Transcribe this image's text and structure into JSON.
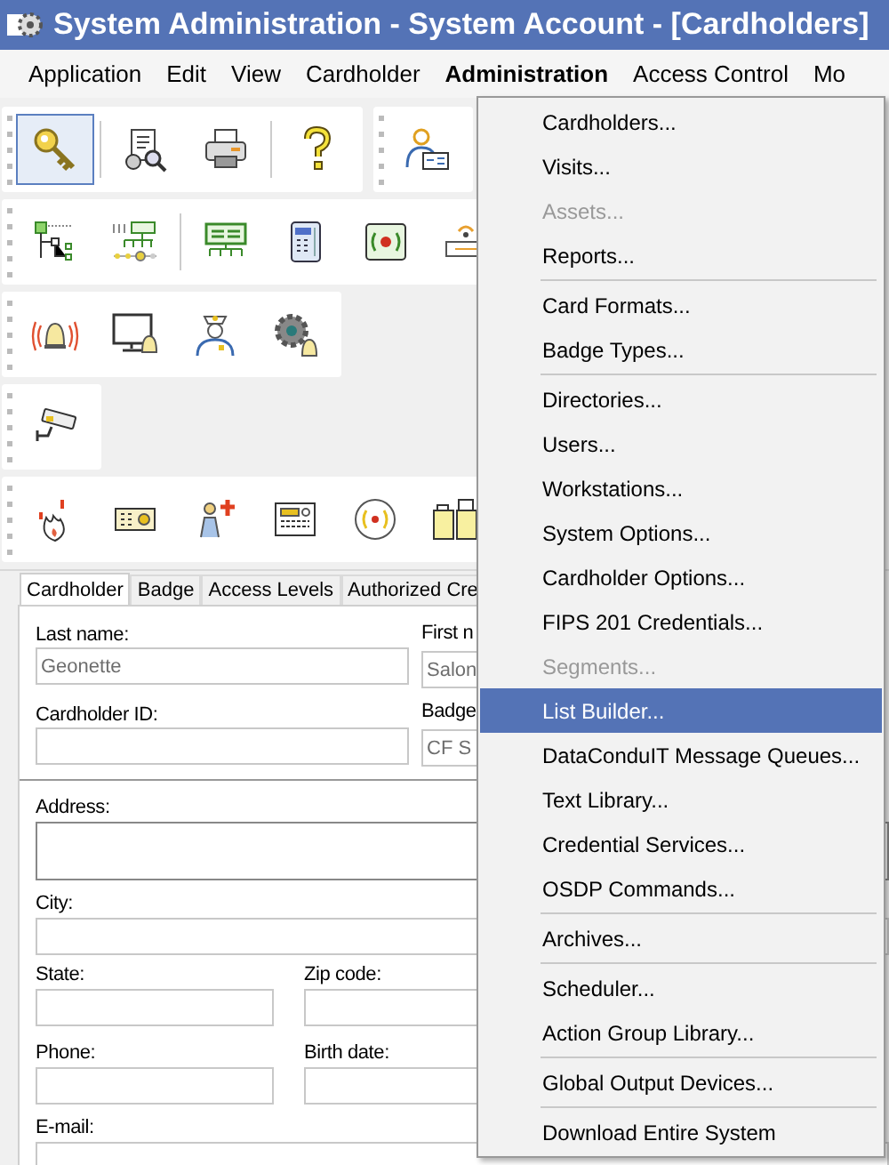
{
  "window": {
    "title": "System Administration - System Account - [Cardholders]"
  },
  "menu_bar": [
    {
      "label": "Application",
      "selected": false
    },
    {
      "label": "Edit",
      "selected": false
    },
    {
      "label": "View",
      "selected": false
    },
    {
      "label": "Cardholder",
      "selected": false
    },
    {
      "label": "Administration",
      "selected": true
    },
    {
      "label": "Access Control",
      "selected": false
    },
    {
      "label": "Mo",
      "selected": false
    }
  ],
  "toolbars": [
    {
      "buttons": [
        {
          "kind": "button",
          "selected": true
        },
        {
          "kind": "separator"
        },
        {
          "kind": "button",
          "selected": false
        },
        {
          "kind": "button",
          "selected": false
        },
        {
          "kind": "separator"
        },
        {
          "kind": "button",
          "selected": false
        }
      ]
    },
    {
      "buttons": [
        {
          "kind": "button",
          "selected": false
        }
      ]
    },
    {
      "buttons": [
        {
          "kind": "button",
          "selected": false
        },
        {
          "kind": "button",
          "selected": false
        },
        {
          "kind": "separator"
        },
        {
          "kind": "button",
          "selected": false
        },
        {
          "kind": "button",
          "selected": false
        },
        {
          "kind": "button",
          "selected": false
        },
        {
          "kind": "button",
          "selected": false
        }
      ]
    },
    {
      "buttons": [
        {
          "kind": "button",
          "selected": false
        },
        {
          "kind": "button",
          "selected": false
        },
        {
          "kind": "button",
          "selected": false
        },
        {
          "kind": "button",
          "selected": false
        }
      ]
    },
    {
      "buttons": [
        {
          "kind": "button",
          "selected": false
        }
      ]
    },
    {
      "buttons": [
        {
          "kind": "button",
          "selected": false
        },
        {
          "kind": "button",
          "selected": false
        },
        {
          "kind": "button",
          "selected": false
        },
        {
          "kind": "button",
          "selected": false
        },
        {
          "kind": "button",
          "selected": false
        },
        {
          "kind": "button",
          "selected": false
        }
      ]
    }
  ],
  "tabs": [
    {
      "label": "Cardholder",
      "selected": true
    },
    {
      "label": "Badge",
      "selected": false
    },
    {
      "label": "Access Levels",
      "selected": false
    },
    {
      "label": "Authorized Cre",
      "selected": false
    }
  ],
  "form": {
    "last_name": {
      "label": "Last name:",
      "value": "Geonette",
      "disabled": true
    },
    "first_name": {
      "label": "First n",
      "value": "Salon",
      "disabled": true
    },
    "cardholder_id": {
      "label": "Cardholder ID:"
    },
    "badge": {
      "label": "Badge",
      "value": "CF S",
      "disabled": true
    },
    "address": {
      "label": "Address:"
    },
    "city": {
      "label": "City:"
    },
    "state": {
      "label": "State:"
    },
    "zip_code": {
      "label": "Zip code:"
    },
    "phone": {
      "label": "Phone:"
    },
    "birth_date": {
      "label": "Birth date:"
    },
    "email": {
      "label": "E-mail:"
    }
  },
  "dropdown_menu": [
    {
      "kind": "item",
      "label": "Cardholders...",
      "disabled": false,
      "selected": false
    },
    {
      "kind": "item",
      "label": "Visits...",
      "disabled": false,
      "selected": false
    },
    {
      "kind": "item",
      "label": "Assets...",
      "disabled": true,
      "selected": false
    },
    {
      "kind": "item",
      "label": "Reports...",
      "disabled": false,
      "selected": false
    },
    {
      "kind": "separator"
    },
    {
      "kind": "item",
      "label": "Card Formats...",
      "disabled": false,
      "selected": false
    },
    {
      "kind": "item",
      "label": "Badge Types...",
      "disabled": false,
      "selected": false
    },
    {
      "kind": "separator"
    },
    {
      "kind": "item",
      "label": "Directories...",
      "disabled": false,
      "selected": false
    },
    {
      "kind": "item",
      "label": "Users...",
      "disabled": false,
      "selected": false
    },
    {
      "kind": "item",
      "label": "Workstations...",
      "disabled": false,
      "selected": false
    },
    {
      "kind": "item",
      "label": "System Options...",
      "disabled": false,
      "selected": false
    },
    {
      "kind": "item",
      "label": "Cardholder Options...",
      "disabled": false,
      "selected": false
    },
    {
      "kind": "item",
      "label": "FIPS 201 Credentials...",
      "disabled": false,
      "selected": false
    },
    {
      "kind": "item",
      "label": "Segments...",
      "disabled": true,
      "selected": false
    },
    {
      "kind": "item",
      "label": "List Builder...",
      "disabled": false,
      "selected": true
    },
    {
      "kind": "item",
      "label": "DataConduIT Message Queues...",
      "disabled": false,
      "selected": false
    },
    {
      "kind": "item",
      "label": "Text Library...",
      "disabled": false,
      "selected": false
    },
    {
      "kind": "item",
      "label": "Credential Services...",
      "disabled": false,
      "selected": false
    },
    {
      "kind": "item",
      "label": "OSDP Commands...",
      "disabled": false,
      "selected": false
    },
    {
      "kind": "separator"
    },
    {
      "kind": "item",
      "label": "Archives...",
      "disabled": false,
      "selected": false
    },
    {
      "kind": "separator"
    },
    {
      "kind": "item",
      "label": "Scheduler...",
      "disabled": false,
      "selected": false
    },
    {
      "kind": "item",
      "label": "Action Group Library...",
      "disabled": false,
      "selected": false
    },
    {
      "kind": "separator"
    },
    {
      "kind": "item",
      "label": "Global Output Devices...",
      "disabled": false,
      "selected": false
    },
    {
      "kind": "separator"
    },
    {
      "kind": "item",
      "label": "Download Entire System",
      "disabled": false,
      "selected": false
    }
  ]
}
